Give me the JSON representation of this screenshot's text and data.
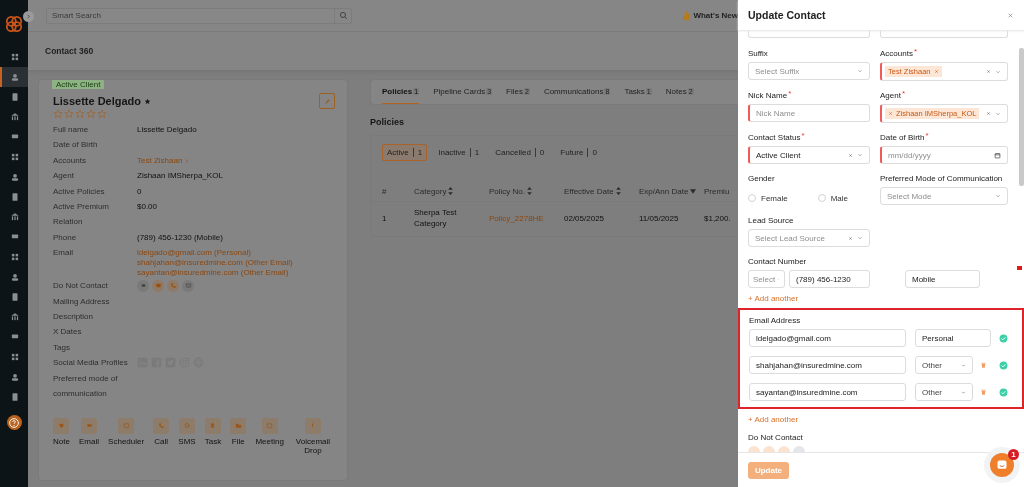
{
  "sidebar": {
    "items": [
      {
        "selected": false
      },
      {
        "selected": true
      },
      {
        "selected": false
      },
      {
        "selected": false
      },
      {
        "selected": false
      },
      {
        "selected": false
      },
      {
        "selected": false
      },
      {
        "selected": false
      },
      {
        "selected": false
      },
      {
        "selected": false
      },
      {
        "selected": false
      },
      {
        "selected": false
      },
      {
        "selected": false
      },
      {
        "selected": false
      },
      {
        "selected": false
      },
      {
        "selected": false
      },
      {
        "selected": false
      },
      {
        "selected": false
      }
    ]
  },
  "topbar": {
    "search": {
      "placeholder": "Smart Search"
    },
    "whats_new": "What's New"
  },
  "page_title": "Contact 360",
  "contact": {
    "status_badge": "Active Client",
    "name": "Lissette Delgado",
    "stars": 0,
    "fields": [
      {
        "kind": "text",
        "label": "Full name",
        "value": "Lissette Delgado"
      },
      {
        "kind": "text",
        "label": "Date of Birth"
      },
      {
        "kind": "link",
        "label": "Accounts",
        "value": "Test Zishaan"
      },
      {
        "kind": "text",
        "label": "Agent",
        "value": "Zishaan IMSherpa_KOL"
      },
      {
        "kind": "text",
        "label": "Active Policies",
        "value": "0"
      },
      {
        "kind": "text",
        "label": "Active Premium",
        "value": "$0.00"
      },
      {
        "kind": "text",
        "label": "Relation"
      },
      {
        "kind": "text",
        "label": "Phone",
        "value": "(789) 456-1230 (Mobile)"
      },
      {
        "kind": "emails",
        "label": "Email",
        "emails": [
          {
            "address": "ldelgado@gmail.com",
            "type": "(Personal)"
          },
          {
            "address": "shahjahan@insuredmine.com",
            "type": "(Other Email)"
          },
          {
            "address": "sayantan@insuredmine.com",
            "type": "(Other Email)"
          }
        ]
      },
      {
        "kind": "channels",
        "label": "Do Not Contact",
        "channels": [
          {
            "kind": "sms",
            "on": false
          },
          {
            "kind": "email",
            "on": true
          },
          {
            "kind": "call",
            "on": true
          },
          {
            "kind": "mail",
            "on": false
          }
        ]
      },
      {
        "kind": "text",
        "label": "Mailing Address"
      },
      {
        "kind": "text",
        "label": "Description"
      },
      {
        "kind": "text",
        "label": "X Dates"
      },
      {
        "kind": "text",
        "label": "Tags"
      },
      {
        "kind": "social",
        "label": "Social Media Profiles"
      },
      {
        "kind": "text",
        "label": "Preferred mode of communication"
      }
    ],
    "actions": [
      "Note",
      "Email",
      "Scheduler",
      "Call",
      "SMS",
      "Task",
      "File",
      "Meeting",
      "Voicemail Drop"
    ]
  },
  "tabs": [
    {
      "label": "Policies",
      "count": "1",
      "selected": true
    },
    {
      "label": "Pipeline Cards",
      "count": "3",
      "selected": false
    },
    {
      "label": "Files",
      "count": "2",
      "selected": false
    },
    {
      "label": "Communications",
      "count": "8",
      "selected": false
    },
    {
      "label": "Tasks",
      "count": "1",
      "selected": false
    },
    {
      "label": "Notes",
      "count": "2",
      "selected": false
    }
  ],
  "policies": {
    "title": "Policies",
    "filters": [
      {
        "label": "Active",
        "count": "1",
        "selected": true
      },
      {
        "label": "Inactive",
        "count": "1",
        "selected": false
      },
      {
        "label": "Cancelled",
        "count": "0",
        "selected": false
      },
      {
        "label": "Future",
        "count": "0",
        "selected": false
      }
    ],
    "table": {
      "columns": [
        {
          "label": "#",
          "sortable": false,
          "kind": "text"
        },
        {
          "label": "Category",
          "sortable": true,
          "sorted_desc": false,
          "kind": "text"
        },
        {
          "label": "Policy No.",
          "sortable": true,
          "sorted_desc": false,
          "kind": "link"
        },
        {
          "label": "Effective Date",
          "sortable": true,
          "sorted_desc": false,
          "kind": "text"
        },
        {
          "label": "Exp/Ann Date",
          "sortable": true,
          "sorted_desc": true,
          "kind": "text"
        },
        {
          "label": "Premiu",
          "sortable": false,
          "kind": "text"
        }
      ],
      "rows": [
        {
          "cells": [
            "1",
            "Sherpa Test Category",
            "Policy_2278HE",
            "02/05/2025",
            "11/05/2025",
            "$1,200."
          ]
        }
      ]
    }
  },
  "modal": {
    "title": "Update Contact",
    "fields": [
      {
        "kind": "select",
        "label": "Suffix",
        "placeholder": "Select Suffix",
        "clearable": false
      },
      {
        "kind": "tags",
        "label": "Accounts",
        "required_mark": "*",
        "tags": [
          "Test Zishaan"
        ],
        "remove_first": false
      },
      {
        "kind": "input",
        "label": "Nick Name",
        "required_mark": "*",
        "placeholder": "Nick Name"
      },
      {
        "kind": "tags",
        "label": "Agent",
        "required_mark": "*",
        "tags": [
          "Zishaan IMSherpa_KOL"
        ],
        "remove_first": true
      },
      {
        "kind": "select",
        "label": "Contact Status",
        "required_mark": "*",
        "value": "Active Client",
        "clearable": true
      },
      {
        "kind": "date",
        "label": "Date of Birth",
        "required_mark": "*",
        "placeholder": "mm/dd/yyyy"
      },
      {
        "kind": "radios",
        "label": "Gender",
        "options": [
          {
            "label": "Female",
            "selected": false
          },
          {
            "label": "Male",
            "selected": false
          }
        ]
      },
      {
        "kind": "select",
        "label": "Preferred Mode of Communication",
        "placeholder": "Select Mode",
        "clearable": false
      },
      {
        "kind": "select",
        "label": "Lead Source",
        "placeholder": "Select Lead Source",
        "clearable": true
      }
    ],
    "contact_number": {
      "label": "Contact Number",
      "code_placeholder": "Select",
      "number": "(789) 456-1230",
      "type": "Mobile"
    },
    "add_phone": "+ Add another",
    "email_section": {
      "label": "Email Address",
      "highlighted": true,
      "emails": [
        {
          "address": "ldelgado@gmail.com",
          "type": "Personal",
          "kind": "fixed",
          "deletable": false,
          "verified": true
        },
        {
          "address": "shahjahan@insuredmine.com",
          "type": "Other",
          "kind": "select",
          "deletable": true,
          "verified": true
        },
        {
          "address": "sayantan@insuredmine.com",
          "type": "Other",
          "kind": "select",
          "deletable": true,
          "verified": true
        }
      ]
    },
    "add_email": "+ Add another",
    "do_not_contact": {
      "label": "Do Not Contact"
    },
    "submit": {
      "label": "Update",
      "disabled": true
    }
  },
  "chat": {
    "badge": "1"
  }
}
